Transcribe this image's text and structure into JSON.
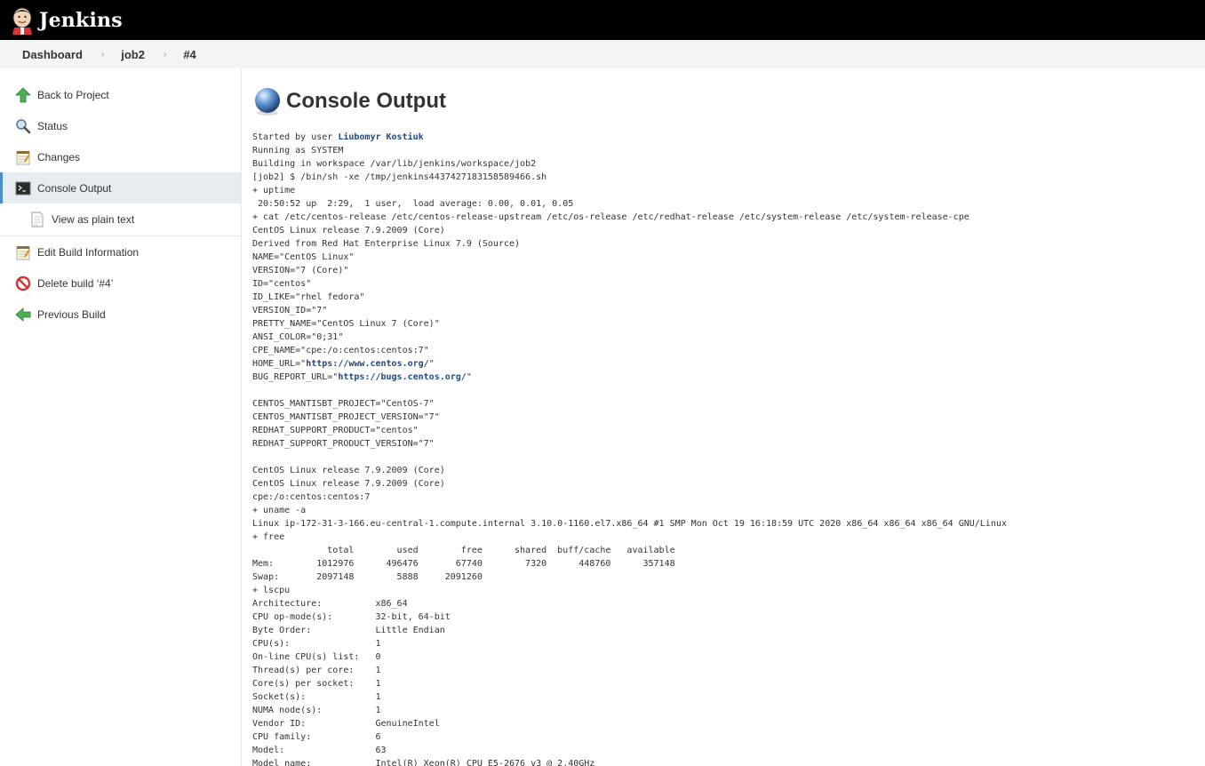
{
  "header": {
    "brand": "Jenkins",
    "logo_icon": "jenkins-butler-icon"
  },
  "breadcrumb": [
    "Dashboard",
    "job2",
    "#4"
  ],
  "sidebar": {
    "items": [
      {
        "label": "Back to Project",
        "icon": "up-arrow-icon"
      },
      {
        "label": "Status",
        "icon": "magnifier-icon"
      },
      {
        "label": "Changes",
        "icon": "notepad-icon"
      },
      {
        "label": "Console Output",
        "icon": "terminal-icon"
      },
      {
        "label": "View as plain text",
        "icon": "document-icon"
      },
      {
        "label": "Edit Build Information",
        "icon": "notepad-icon"
      },
      {
        "label": "Delete build ‘#4’",
        "icon": "no-entry-icon"
      },
      {
        "label": "Previous Build",
        "icon": "left-arrow-icon"
      }
    ]
  },
  "main": {
    "title": "Console Output",
    "title_icon": "blue-ball-icon",
    "console": {
      "started_prefix": "Started by user ",
      "user": "Liubomyr Kostiuk",
      "block1": "Running as SYSTEM\nBuilding in workspace /var/lib/jenkins/workspace/job2\n[job2] $ /bin/sh -xe /tmp/jenkins4437427183158589466.sh\n+ uptime\n 20:50:52 up  2:29,  1 user,  load average: 0.00, 0.01, 0.05\n+ cat /etc/centos-release /etc/centos-release-upstream /etc/os-release /etc/redhat-release /etc/system-release /etc/system-release-cpe\nCentOS Linux release 7.9.2009 (Core)\nDerived from Red Hat Enterprise Linux 7.9 (Source)\nNAME=\"CentOS Linux\"\nVERSION=\"7 (Core)\"\nID=\"centos\"\nID_LIKE=\"rhel fedora\"\nVERSION_ID=\"7\"\nPRETTY_NAME=\"CentOS Linux 7 (Core)\"\nANSI_COLOR=\"0;31\"\nCPE_NAME=\"cpe:/o:centos:centos:7\"",
      "home_prefix": "HOME_URL=\"",
      "home_url": "https://www.centos.org/",
      "home_suffix": "\"",
      "bug_prefix": "BUG_REPORT_URL=\"",
      "bug_url": "https://bugs.centos.org/",
      "bug_suffix": "\"",
      "block2": "\nCENTOS_MANTISBT_PROJECT=\"CentOS-7\"\nCENTOS_MANTISBT_PROJECT_VERSION=\"7\"\nREDHAT_SUPPORT_PRODUCT=\"centos\"\nREDHAT_SUPPORT_PRODUCT_VERSION=\"7\"\n\nCentOS Linux release 7.9.2009 (Core)\nCentOS Linux release 7.9.2009 (Core)\ncpe:/o:centos:centos:7\n+ uname -a\nLinux ip-172-31-3-166.eu-central-1.compute.internal 3.10.0-1160.el7.x86_64 #1 SMP Mon Oct 19 16:18:59 UTC 2020 x86_64 x86_64 x86_64 GNU/Linux\n+ free\n              total        used        free      shared  buff/cache   available\nMem:        1012976      496476       67740        7320      448760      357148\nSwap:       2097148        5888     2091260\n+ lscpu\nArchitecture:          x86_64\nCPU op-mode(s):        32-bit, 64-bit\nByte Order:            Little Endian\nCPU(s):                1\nOn-line CPU(s) list:   0\nThread(s) per core:    1\nCore(s) per socket:    1\nSocket(s):             1\nNUMA node(s):          1\nVendor ID:             GenuineIntel\nCPU family:            6\nModel:                 63\nModel name:            Intel(R) Xeon(R) CPU E5-2676 v3 @ 2.40GHz"
    }
  }
}
